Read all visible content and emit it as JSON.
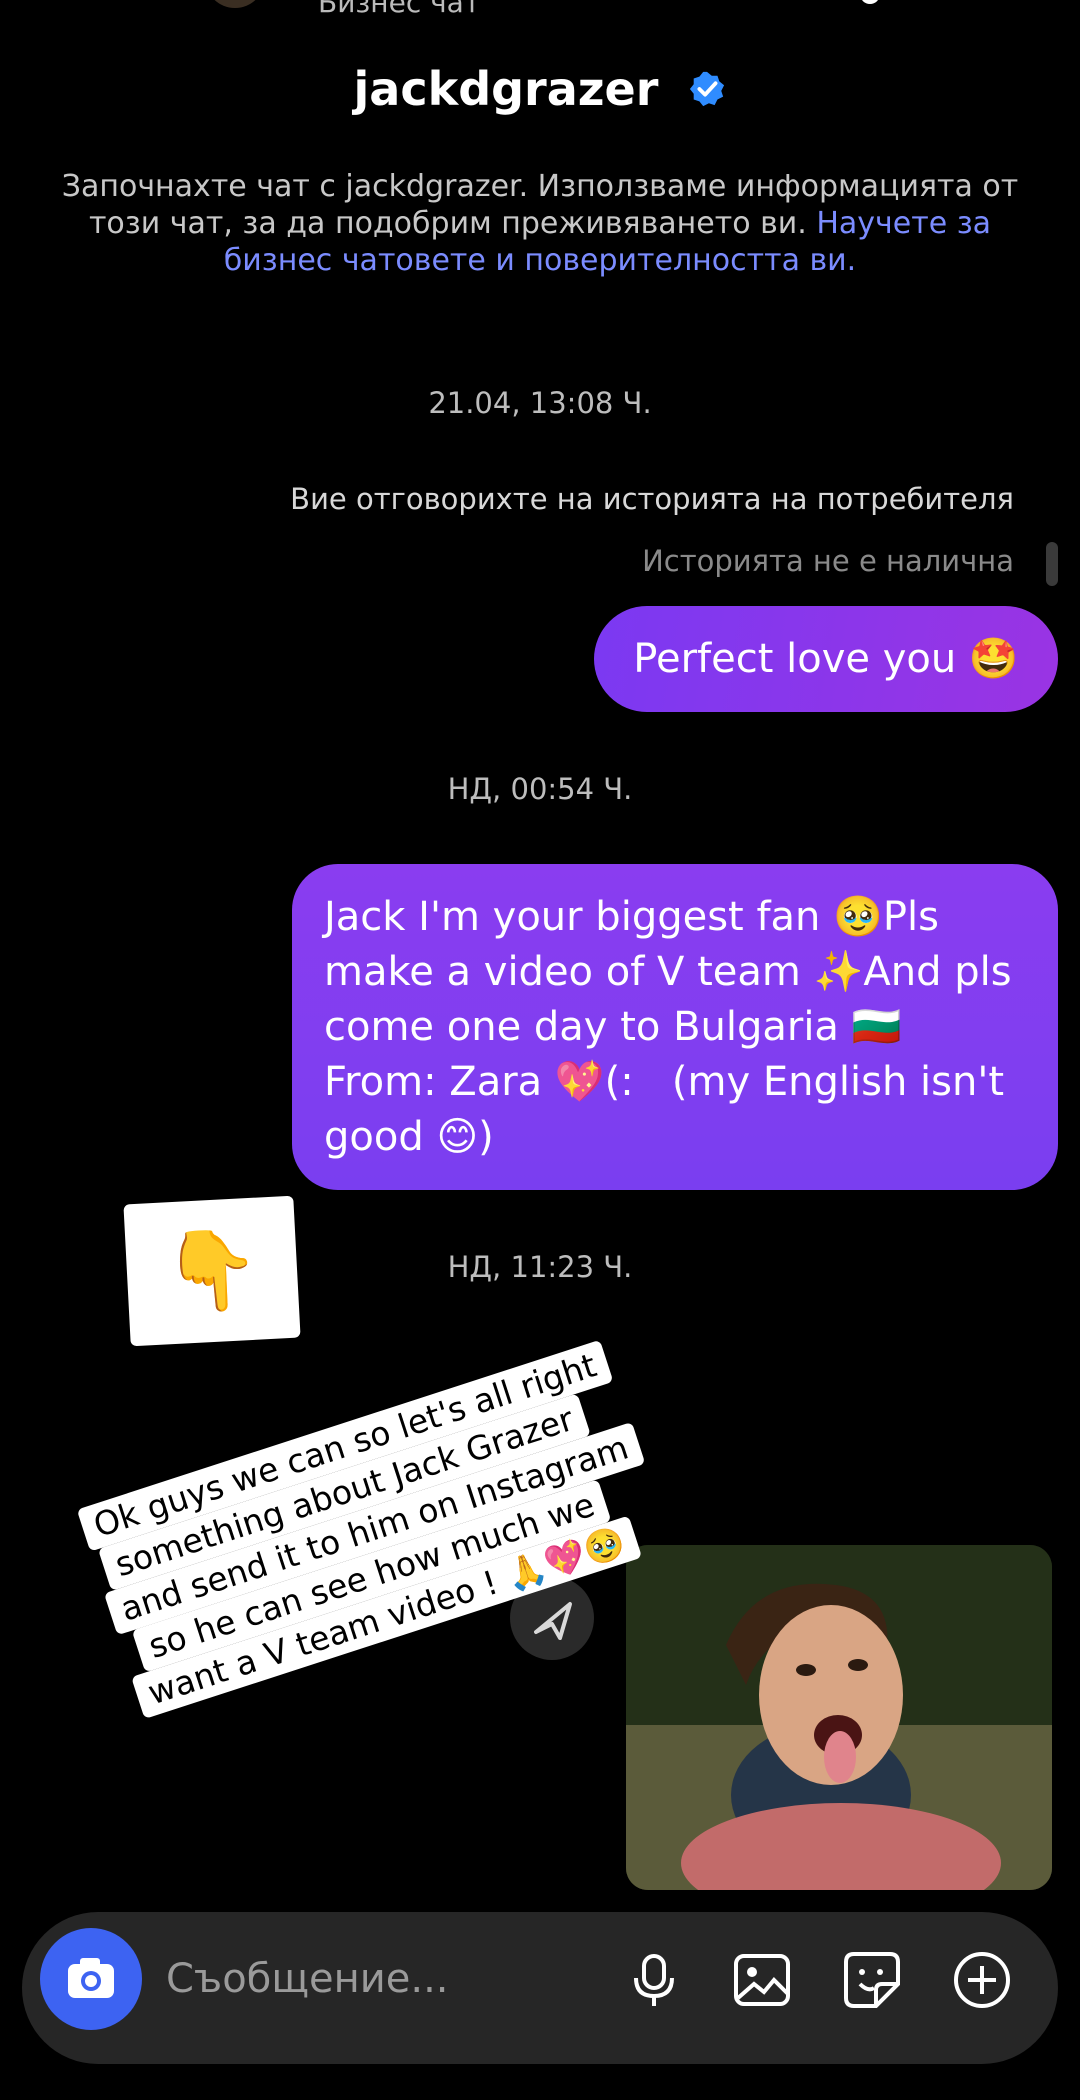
{
  "header": {
    "subtitle": "Бизнес чат",
    "username": "jackdgrazer"
  },
  "intro": {
    "text": "Започнахте чат с jackdgrazer. Използваме информацията от този чат, за да подобрим преживяването ви. ",
    "link": "Научете за бизнес чатовете и поверителността ви."
  },
  "messages": {
    "ts1": "21.04, 13:08 Ч.",
    "reply_note": "Вие отговорихте на историята на потребителя",
    "story_unavailable": "Историята не е налична",
    "msg1": "Perfect love you 🤩",
    "ts2": "НД, 00:54 Ч.",
    "msg2": "Jack I'm your biggest fan 🥹Pls make a video of V team ✨And pls come one day to Bulgaria 🇧🇬 From: Zara 💖(:   (my English isn't good 😊)",
    "ts3": "НД, 11:23 Ч."
  },
  "overlay": {
    "pointer_emoji": "👇",
    "sticker_lines": [
      "Ok guys we can so let's all right",
      "something about Jack Grazer",
      "and send it to him on Instagram",
      "so he can see how much we",
      "want a V team video ! 🙏💖🥹"
    ]
  },
  "composer": {
    "placeholder": "Съобщение..."
  },
  "icons": {
    "camera": "camera-icon",
    "mic": "microphone-icon",
    "gallery": "gallery-icon",
    "sticker": "sticker-icon",
    "plus": "plus-circle-icon",
    "send": "send-icon",
    "verified": "verified-badge-icon"
  },
  "colors": {
    "background": "#000000",
    "bubble": "#8a3df0",
    "link": "#7b8cff",
    "camera_button": "#3d63f2",
    "composer": "#262626"
  }
}
